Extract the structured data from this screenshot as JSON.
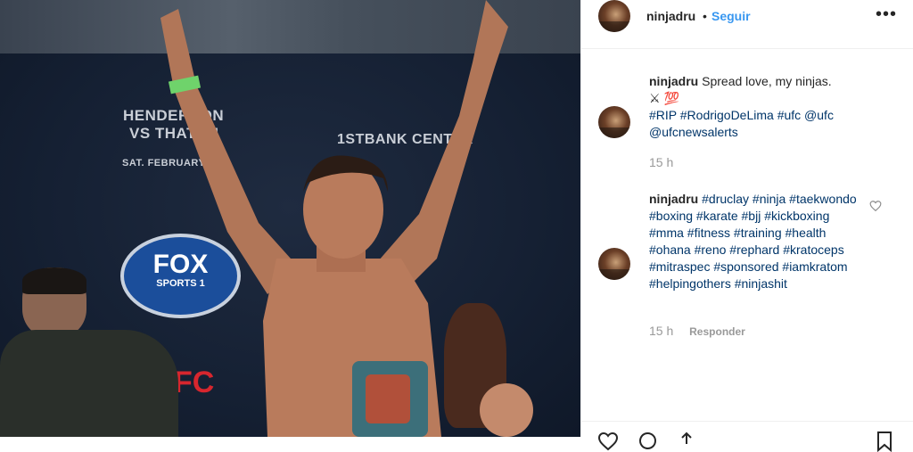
{
  "post": {
    "username": "ninjadru",
    "separator": "•",
    "follow_label": "Seguir",
    "more_label": "•••"
  },
  "photo": {
    "sponsor_1_line1": "HENDERSON",
    "sponsor_1_line2": "VS THATCH",
    "sponsor_1_line3": "SAT. FEBRUARY 14",
    "sponsor_2": "1STBANK CENTER",
    "fox_line1": "FOX",
    "fox_line2": "SPORTS 1",
    "ufc_text": "FC"
  },
  "comments": [
    {
      "username": "ninjadru",
      "text_prefix": "Spread love, my ninjas.",
      "emoji": "⚔ 💯",
      "tags": "#RIP #RodrigoDeLima #ufc @ufc @ufcnewsalerts",
      "time": "15 h",
      "reply": ""
    },
    {
      "username": "ninjadru",
      "tags": "#druclay #ninja #taekwondo #boxing #karate #bjj #kickboxing #mma #fitness #training #health #ohana #reno #rephard #kratoceps #mitraspec #sponsored #iamkratom #helpingothers #ninjashit",
      "time": "15 h",
      "reply": "Responder"
    }
  ],
  "icons": {
    "like": "heart-icon",
    "comment": "comment-icon",
    "share": "share-icon",
    "save": "bookmark-icon"
  },
  "colors": {
    "link": "#3897f0",
    "tag": "#003569",
    "text": "#262626",
    "muted": "#999999"
  }
}
